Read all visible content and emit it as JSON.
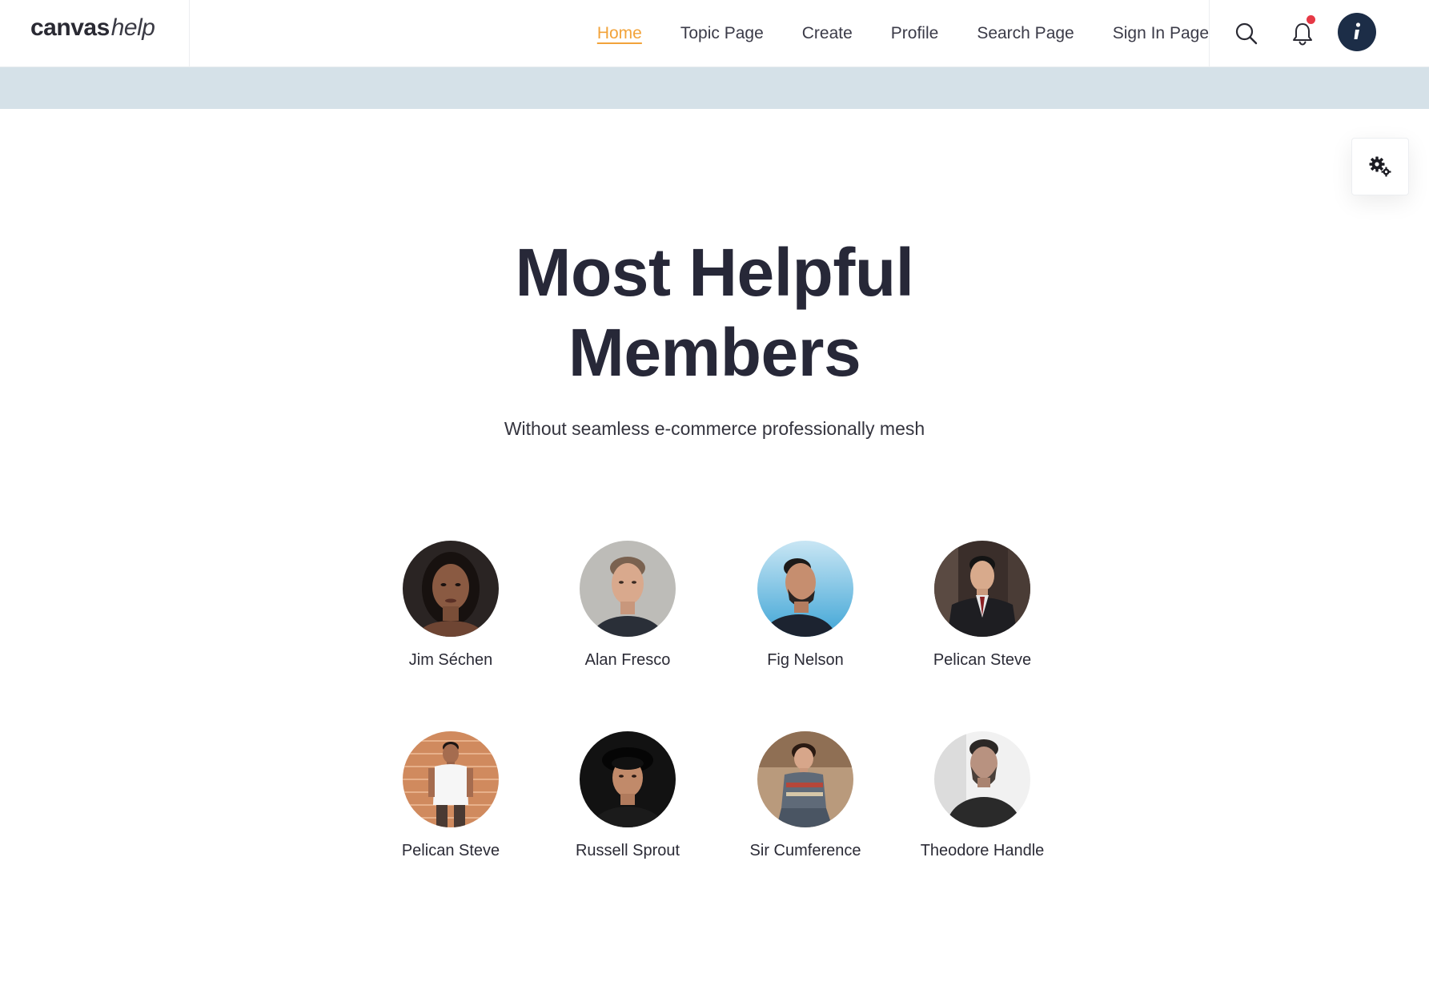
{
  "brand": {
    "name_bold": "canvas",
    "name_light": "help"
  },
  "nav": {
    "items": [
      {
        "label": "Home",
        "active": true
      },
      {
        "label": "Topic Page",
        "active": false
      },
      {
        "label": "Create",
        "active": false
      },
      {
        "label": "Profile",
        "active": false
      },
      {
        "label": "Search Page",
        "active": false
      },
      {
        "label": "Sign In Page",
        "active": false
      }
    ]
  },
  "header_tools": {
    "search_icon": "search-icon",
    "notifications_icon": "bell-icon",
    "has_notification": true,
    "info_icon": "info-icon"
  },
  "settings": {
    "icon": "gears-icon"
  },
  "hero": {
    "title_line1": "Most Helpful",
    "title_line2": "Members",
    "subtitle": "Without seamless e-commerce professionally mesh"
  },
  "members": [
    {
      "name": "Jim Séchen"
    },
    {
      "name": "Alan Fresco"
    },
    {
      "name": "Fig Nelson"
    },
    {
      "name": "Pelican Steve"
    },
    {
      "name": "Pelican Steve"
    },
    {
      "name": "Russell Sprout"
    },
    {
      "name": "Sir Cumference"
    },
    {
      "name": "Theodore Handle"
    }
  ],
  "colors": {
    "accent": "#f2a33a",
    "dark": "#1c2d47",
    "band": "#d5e1e8",
    "notification": "#e63946"
  }
}
